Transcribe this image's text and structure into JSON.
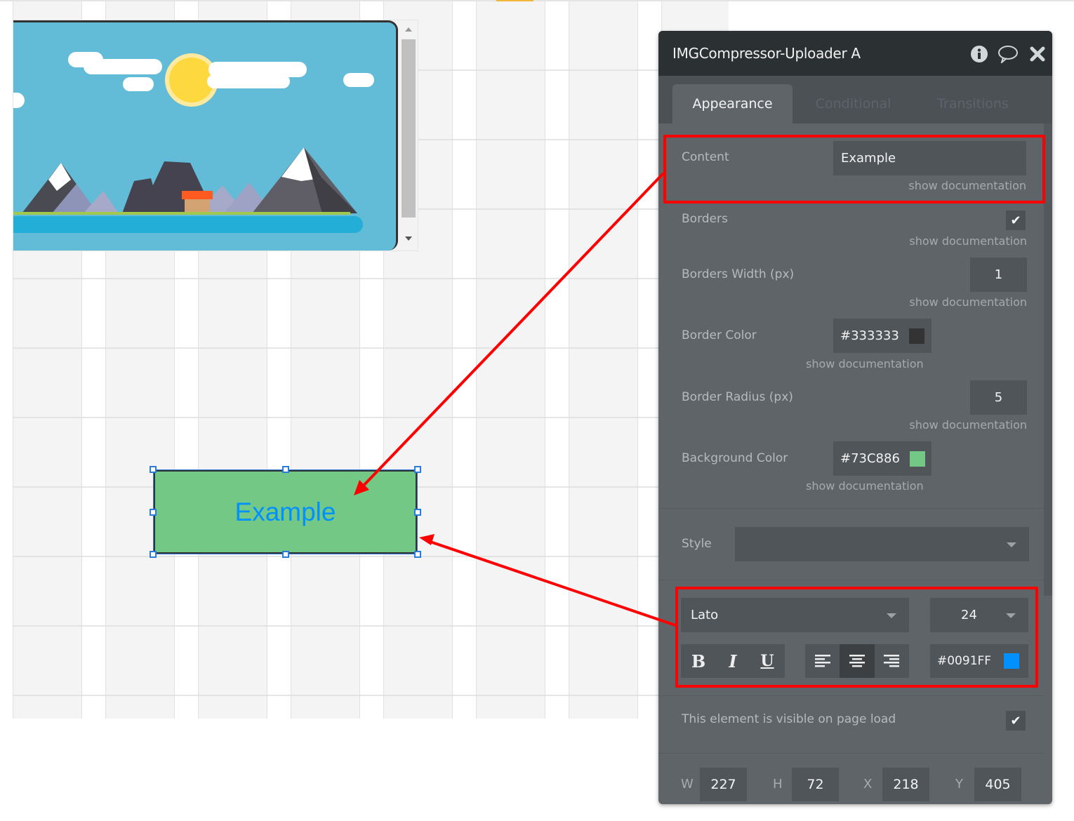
{
  "panel": {
    "title": "IMGCompressor-Uploader A",
    "header_icons": [
      "info-icon",
      "comment-icon",
      "close-icon"
    ],
    "tabs": [
      {
        "label": "Appearance",
        "active": true
      },
      {
        "label": "Conditional",
        "active": false
      },
      {
        "label": "Transitions",
        "active": false
      }
    ],
    "doc_link": "show documentation",
    "content": {
      "label": "Content",
      "value": "Example"
    },
    "borders": {
      "label": "Borders",
      "checked": true
    },
    "borders_width": {
      "label": "Borders Width (px)",
      "value": "1"
    },
    "border_color": {
      "label": "Border Color",
      "value": "#333333",
      "swatch": "#333333"
    },
    "border_radius": {
      "label": "Border Radius (px)",
      "value": "5"
    },
    "background_color": {
      "label": "Background Color",
      "value": "#73C886",
      "swatch": "#73C886"
    },
    "style": {
      "label": "Style",
      "value": ""
    },
    "font": {
      "family": "Lato",
      "size": "24",
      "bold_label": "B",
      "italic_label": "I",
      "underline_label": "U",
      "alignment_options": [
        "left",
        "center",
        "right"
      ],
      "alignment_selected": "center",
      "color_value": "#0091FF",
      "color_swatch": "#0091FF"
    },
    "visible_on_load": {
      "label": "This element is visible on page load",
      "checked": true
    },
    "dimensions": {
      "w_label": "W",
      "w": "227",
      "h_label": "H",
      "h": "72",
      "x_label": "X",
      "x": "218",
      "y_label": "Y",
      "y": "405"
    }
  },
  "canvas": {
    "text_element": {
      "text": "Example",
      "bg_color": "#73C886",
      "text_color": "#0091FF",
      "border_color": "#333333"
    },
    "image_element": {
      "description": "flat landscape illustration with mountains, sun, clouds and house"
    }
  },
  "annotations": {
    "highlight_color": "#FF0000",
    "callouts": [
      "content-field-to-text",
      "font-settings-to-text"
    ]
  }
}
